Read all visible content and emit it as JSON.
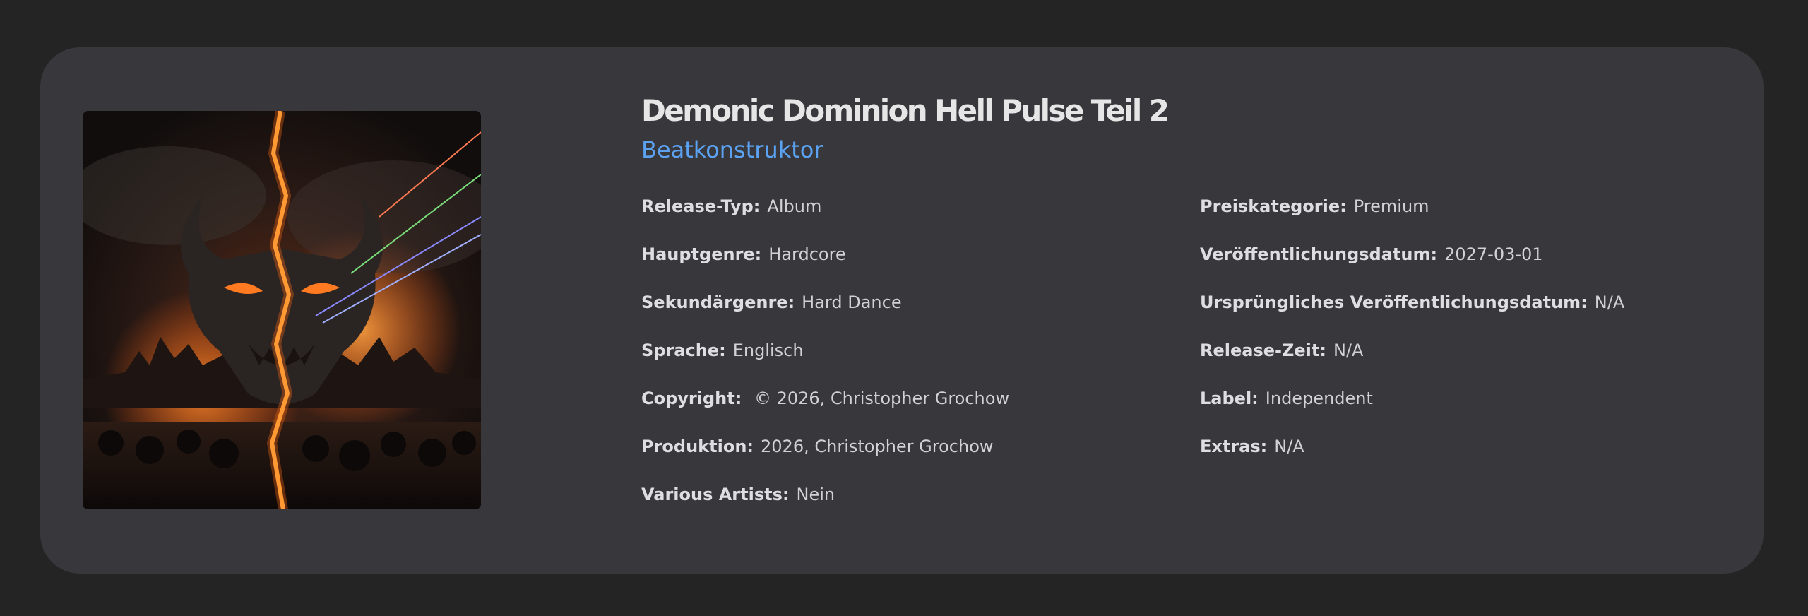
{
  "release": {
    "title": "Demonic Dominion Hell Pulse Teil 2",
    "artist": "Beatkonstruktor",
    "cover_alt": "Albumcover"
  },
  "details_left": [
    {
      "key": "Release-Typ:",
      "value": "Album"
    },
    {
      "key": "Hauptgenre:",
      "value": "Hardcore"
    },
    {
      "key": "Sekundärgenre:",
      "value": "Hard Dance"
    },
    {
      "key": "Sprache:",
      "value": "Englisch"
    },
    {
      "key": "Copyright:",
      "value": " © 2026, Christopher Grochow"
    },
    {
      "key": "Produktion:",
      "value": "2026, Christopher Grochow"
    },
    {
      "key": "Various Artists:",
      "value": "Nein"
    }
  ],
  "details_right": [
    {
      "key": "Preiskategorie:",
      "value": "Premium"
    },
    {
      "key": "Veröffentlichungsdatum:",
      "value": "2027-03-01"
    },
    {
      "key": "Ursprüngliches Veröffentlichungsdatum:",
      "value": "N/A"
    },
    {
      "key": "Release-Zeit:",
      "value": "N/A"
    },
    {
      "key": "Label:",
      "value": "Independent"
    },
    {
      "key": "Extras:",
      "value": "N/A"
    }
  ],
  "colors": {
    "page_bg": "#242424",
    "card_bg": "#38373c",
    "title": "#e6e6e6",
    "artist_accent": "#5ba3f2",
    "text": "#d2d2d4"
  }
}
